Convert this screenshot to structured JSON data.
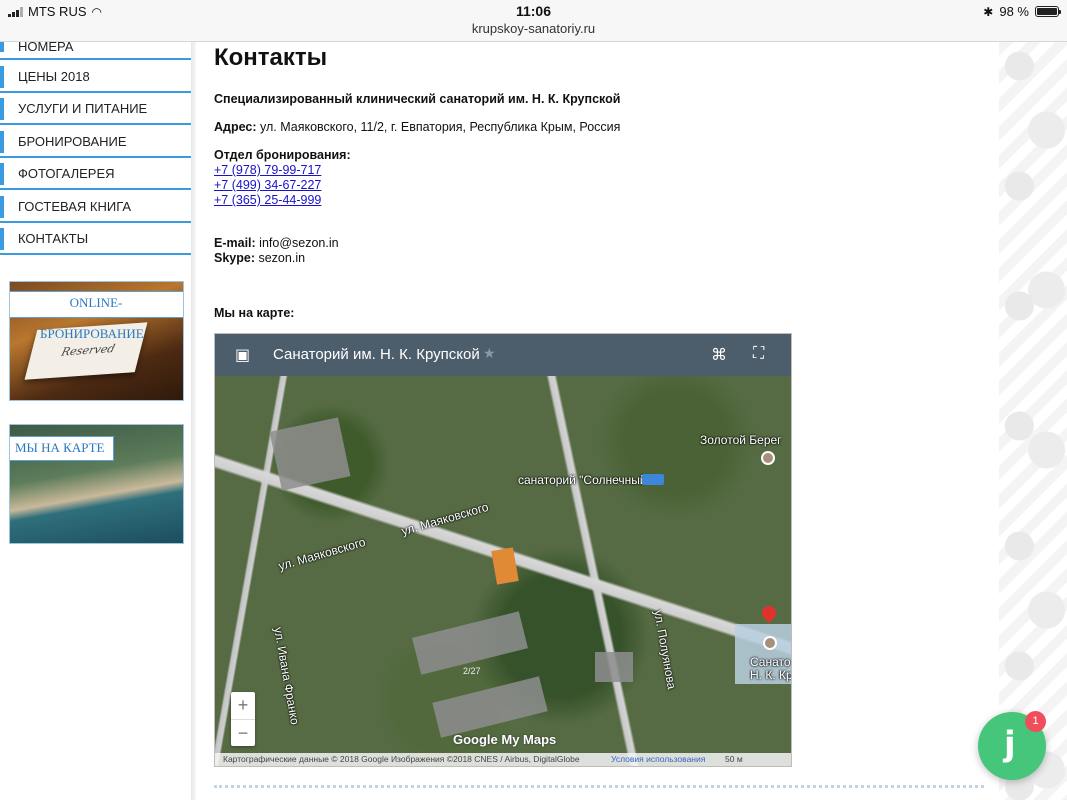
{
  "status": {
    "carrier": "MTS RUS",
    "time": "11:06",
    "url": "krupskoy-sanatoriy.ru",
    "battery": "98 %",
    "battery_level": 0.98
  },
  "menu": {
    "items": [
      {
        "label": "НОМЕРА"
      },
      {
        "label": "ЦЕНЫ 2018"
      },
      {
        "label": "УСЛУГИ И ПИТАНИЕ"
      },
      {
        "label": "БРОНИРОВАНИЕ"
      },
      {
        "label": "ФОТОГАЛЕРЕЯ"
      },
      {
        "label": "ГОСТЕВАЯ КНИГА"
      },
      {
        "label": "КОНТАКТЫ"
      }
    ]
  },
  "promos": {
    "booking": {
      "label_line1": "ONLINE-",
      "label_line2": "БРОНИРОВАНИЕ",
      "card_text": "Reserved"
    },
    "map": {
      "label": "МЫ НА КАРТЕ"
    }
  },
  "contacts": {
    "title": "Контакты",
    "org_name": "Специализированный клинический санаторий им. Н. К. Крупской",
    "address_label": "Адрес:",
    "address": "ул. Маяковского, 11/2, г. Евпатория, Республика Крым, Россия",
    "booking_dept_label": "Отдел бронирования:",
    "phones": [
      "+7 (978) 79-99-717",
      "+7 (499) 34-67-227",
      "+7 (365) 25-44-999"
    ],
    "email_label": "E-mail:",
    "email": "info@sezon.in",
    "skype_label": "Skype:",
    "skype": "sezon.in",
    "map_heading": "Мы на карте:"
  },
  "map": {
    "title": "Санаторий им. Н. К. Крупской",
    "labels": {
      "golden_shore": "Золотой Берег",
      "solnechny": "санаторий \"Солнечный\"",
      "mayakovsky_1": "ул. Маяковского",
      "mayakovsky_2": "ул. Маяковского",
      "franko": "ул. Ивана Франко",
      "poluyanova": "ул. Полуянова",
      "sanat_1": "Санато",
      "sanat_2": "Н. К. Кр",
      "page": "2/27"
    },
    "logo": "Google My Maps",
    "footer_data": "Картографические данные © 2018 Google Изображения ©2018 CNES / Airbus, DigitalGlobe",
    "footer_terms": "Условия использования",
    "footer_scale": "50 м",
    "zoom_in": "+",
    "zoom_out": "−"
  },
  "chat": {
    "badge": "1",
    "glyph": "ј",
    "color": "#45c67a"
  },
  "colors": {
    "accent": "#3b9be0",
    "link": "#1a12c8",
    "map_header": "#4c5d6b"
  }
}
